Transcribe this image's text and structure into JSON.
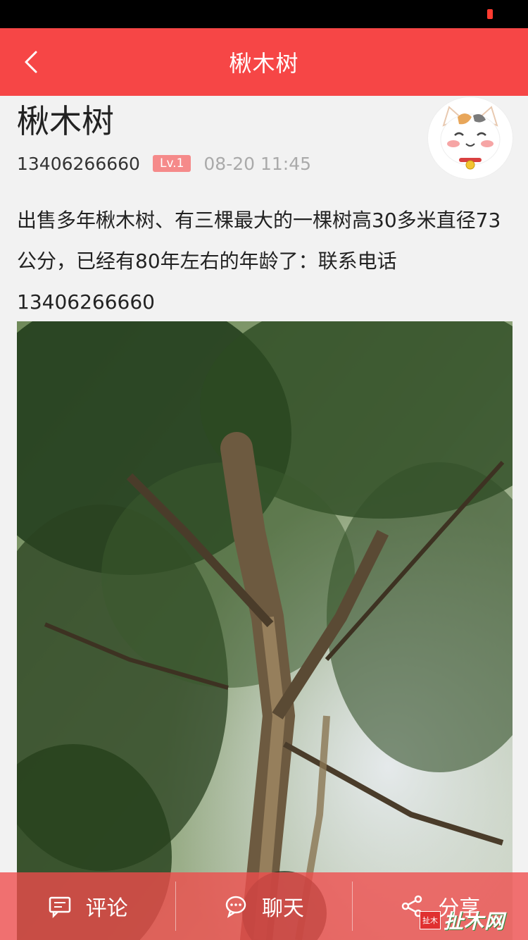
{
  "nav": {
    "title": "楸木树",
    "back_icon": "chevron-left-icon"
  },
  "post": {
    "title": "楸木树",
    "author_phone": "13406266660",
    "level": "Lv.1",
    "time": "08-20 11:45",
    "content": "出售多年楸木树、有三棵最大的一棵树高30多米直径73公分，已经有80年左右的年龄了：联系电话13406266660",
    "avatar_icon": "cat-avatar"
  },
  "actions": {
    "comment": "评论",
    "chat": "聊天",
    "share": "分享"
  },
  "watermark": {
    "badge": "扯木",
    "text": "扯木网"
  },
  "colors": {
    "brand_red": "#f64646",
    "level_badge": "#f58a8a"
  }
}
